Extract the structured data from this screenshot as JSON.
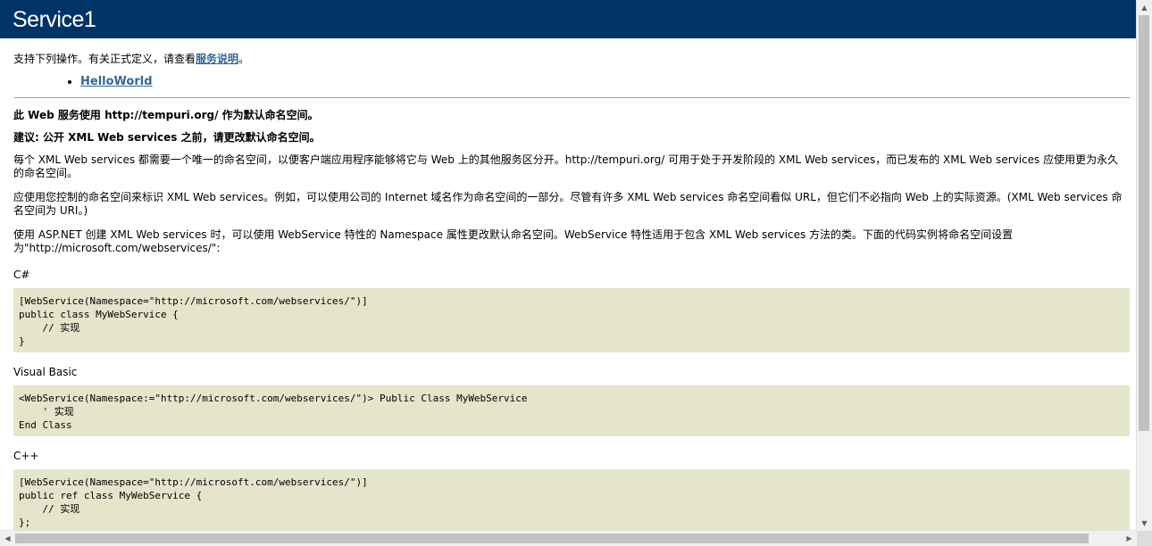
{
  "heading": "Service1",
  "intro": {
    "text": "支持下列操作。有关正式定义，请查看",
    "link": "服务说明",
    "suffix": "。"
  },
  "operations": [
    "HelloWorld"
  ],
  "namespace_notice": "此 Web 服务使用 http://tempuri.org/ 作为默认命名空间。",
  "recommendation": "建议: 公开 XML Web services 之前，请更改默认命名空间。",
  "para1": "每个 XML Web services 都需要一个唯一的命名空间，以便客户端应用程序能够将它与 Web 上的其他服务区分开。http://tempuri.org/ 可用于处于开发阶段的 XML Web services，而已发布的 XML Web services 应使用更为永久的命名空间。",
  "para2": "应使用您控制的命名空间来标识 XML Web services。例如，可以使用公司的 Internet 域名作为命名空间的一部分。尽管有许多 XML Web services 命名空间看似 URL，但它们不必指向 Web 上的实际资源。(XML Web services 命名空间为 URI。)",
  "para3": "使用 ASP.NET 创建 XML Web services 时，可以使用 WebService 特性的 Namespace 属性更改默认命名空间。WebService 特性适用于包含 XML Web services 方法的类。下面的代码实例将命名空间设置为\"http://microsoft.com/webservices/\":",
  "examples": [
    {
      "language": "C#",
      "code": "[WebService(Namespace=\"http://microsoft.com/webservices/\")]\npublic class MyWebService {\n    // 实现\n}"
    },
    {
      "language": "Visual Basic",
      "code": "<WebService(Namespace:=\"http://microsoft.com/webservices/\")> Public Class MyWebService\n    ' 实现\nEnd Class"
    },
    {
      "language": "C++",
      "code": "[WebService(Namespace=\"http://microsoft.com/webservices/\")]\npublic ref class MyWebService {\n    // 实现\n};"
    }
  ]
}
